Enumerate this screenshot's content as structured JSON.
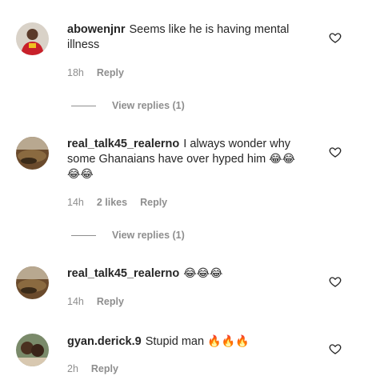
{
  "comments": [
    {
      "username": "abowenjnr",
      "text": "Seems like he is having mental illness",
      "emoji": "",
      "time": "18h",
      "likes": "",
      "reply_label": "Reply",
      "view_replies": "View replies (1)"
    },
    {
      "username": "real_talk45_realerno",
      "text": "I always wonder why some Ghanaians have over hyped him",
      "emoji": "😂😂😂😂",
      "time": "14h",
      "likes": "2 likes",
      "reply_label": "Reply",
      "view_replies": "View replies (1)"
    },
    {
      "username": "real_talk45_realerno",
      "text": "",
      "emoji": "😂😂😂",
      "time": "14h",
      "likes": "",
      "reply_label": "Reply",
      "view_replies": ""
    },
    {
      "username": "gyan.derick.9",
      "text": "Stupid man",
      "emoji": "🔥🔥🔥",
      "time": "2h",
      "likes": "",
      "reply_label": "Reply",
      "view_replies": ""
    }
  ],
  "icons": {
    "like": "heart-outline-icon"
  },
  "colors": {
    "text": "#262626",
    "secondary": "#8e8e8e"
  }
}
